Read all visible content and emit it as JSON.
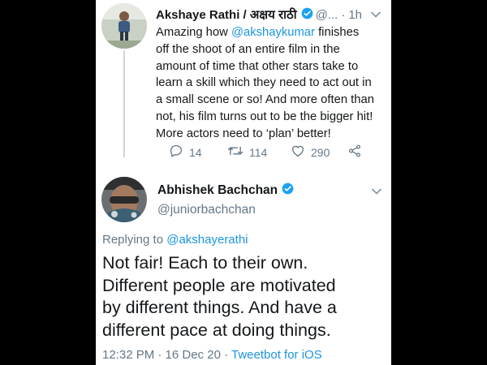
{
  "tweet1": {
    "author_name": "Akshaye Rathi / अक्षय राठी",
    "handle_truncated": "@...",
    "time_sep": "·",
    "time": "1h",
    "body_lines": {
      "l1_prefix": "Amazing how ",
      "l1_mention": "@akshaykumar",
      "l1_suffix": " finishes",
      "l2": "off the shoot of an entire film in the",
      "l3": "amount of time that other stars take to",
      "l4": "learn a skill which they need to act out in",
      "l5": "a small scene or so! And more often than",
      "l6": "not, his film turns out to be the bigger hit!",
      "l7": "More actors need to ‘plan’ better!"
    },
    "actions": {
      "reply_count": "14",
      "retweet_count": "114",
      "like_count": "290"
    }
  },
  "tweet2": {
    "author_name": "Abhishek Bachchan",
    "handle": "@juniorbachchan",
    "replying_prefix": "Replying to ",
    "replying_to": "@akshayerathi",
    "body_lines": {
      "l1": "Not fair! Each to their own.",
      "l2": "Different people are motivated",
      "l3": "by different things. And have a",
      "l4": "different pace at doing things."
    },
    "timestamp": "12:32 PM · 16 Dec 20 · ",
    "source": "Tweetbot for iOS"
  },
  "icons": {
    "verified": "verified-badge-icon",
    "reply": "reply-icon",
    "retweet": "retweet-icon",
    "like": "heart-icon",
    "share": "share-icon",
    "caret": "chevron-down-icon"
  },
  "colors": {
    "link": "#1b95e0",
    "muted": "#657786",
    "text": "#14171a",
    "background_outer": "#000000",
    "card": "#ffffff"
  }
}
